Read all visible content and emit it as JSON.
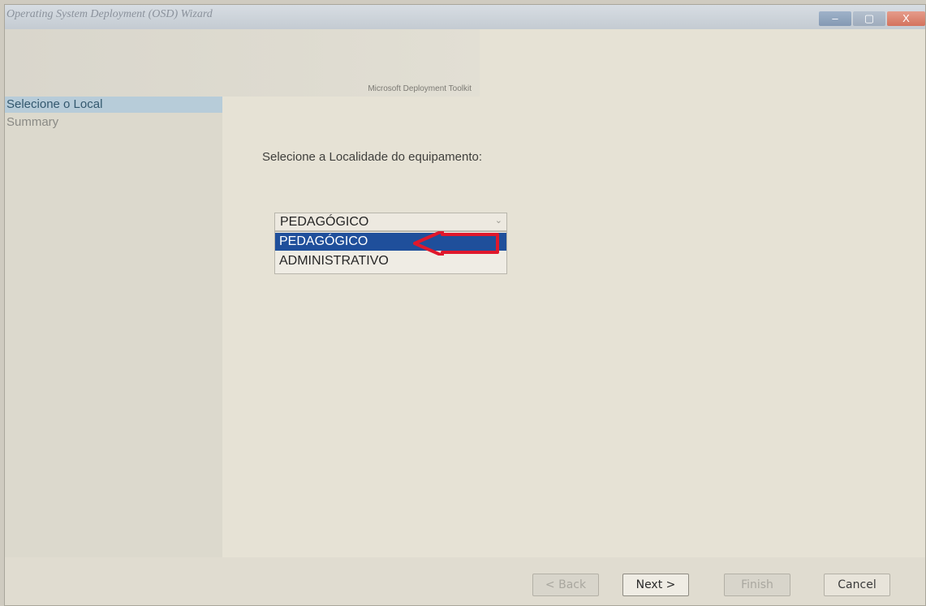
{
  "window": {
    "title": "Operating System Deployment (OSD) Wizard",
    "minimize_glyph": "–",
    "maximize_glyph": "▢",
    "close_glyph": "X"
  },
  "banner": {
    "text": "Microsoft Deployment Toolkit"
  },
  "sidebar": {
    "items": [
      {
        "label": "Selecione o Local",
        "active": true
      },
      {
        "label": "Summary",
        "active": false
      }
    ]
  },
  "content": {
    "prompt": "Selecione a Localidade do equipamento:",
    "location_select": {
      "selected": "PEDAGÓGICO",
      "options": [
        "PEDAGÓGICO",
        "ADMINISTRATIVO"
      ],
      "highlighted_index": 0
    },
    "annotation": "red-arrow-pointing-left"
  },
  "buttons": {
    "back": "< Back",
    "next": "Next >",
    "finish": "Finish",
    "cancel": "Cancel"
  },
  "colors": {
    "highlight": "#1f4f9b",
    "sidebar_active": "#b7ccd9",
    "annotation_arrow": "#e0182c"
  }
}
